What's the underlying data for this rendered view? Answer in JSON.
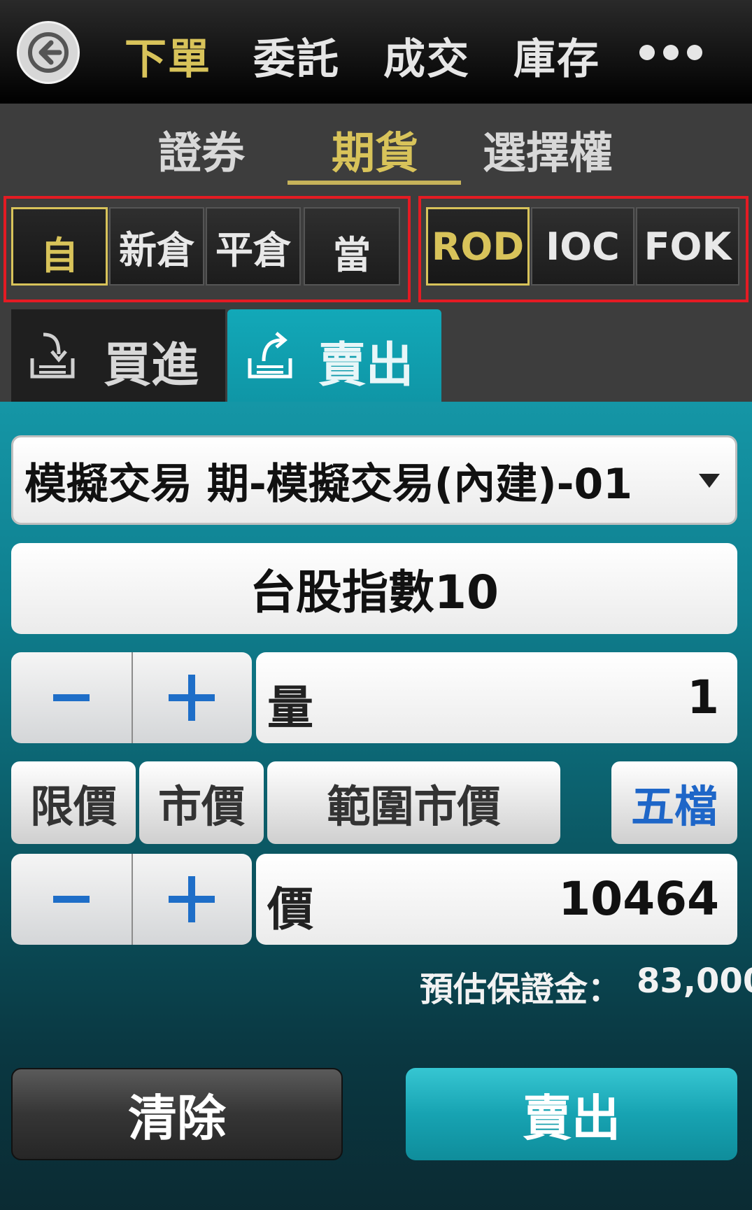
{
  "header": {
    "tabs": [
      {
        "label": "下單",
        "active": true
      },
      {
        "label": "委託",
        "active": false
      },
      {
        "label": "成交",
        "active": false
      },
      {
        "label": "庫存",
        "active": false
      }
    ],
    "more_icon": "more-dots-icon",
    "back_icon": "back-arrow-icon"
  },
  "segments": [
    {
      "label": "證券",
      "active": false
    },
    {
      "label": "期貨",
      "active": true
    },
    {
      "label": "選擇權",
      "active": false
    }
  ],
  "position_types": [
    "自",
    "新倉",
    "平倉",
    "當"
  ],
  "time_in_force": [
    "ROD",
    "IOC",
    "FOK"
  ],
  "side_tabs": {
    "buy": "買進",
    "sell": "賣出",
    "active": "sell"
  },
  "order": {
    "account": "模擬交易 期-模擬交易(內建)-01",
    "symbol": "台股指數10",
    "qty_label": "量",
    "qty_value": "1",
    "price_label": "價",
    "price_value": "10464"
  },
  "price_types": [
    "限價",
    "市價",
    "範圍市價"
  ],
  "five_levels_label": "五檔",
  "margin": {
    "label": "預估保證金：",
    "value": "83,000"
  },
  "actions": {
    "clear": "清除",
    "submit": "賣出"
  },
  "colors": {
    "accent_gold": "#d8c35a",
    "highlight_red": "#e41b23",
    "teal": "#12a8b8",
    "blue": "#1e66c8"
  }
}
